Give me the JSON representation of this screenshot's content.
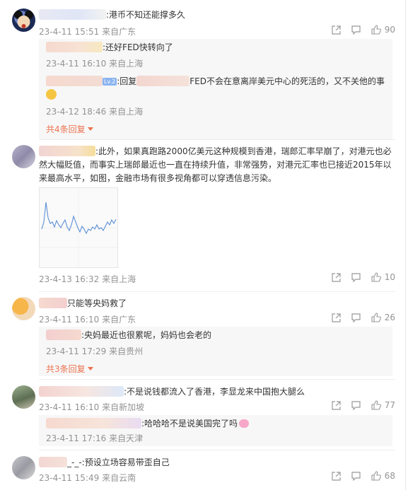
{
  "comments": [
    {
      "text": ":港币不知还能撑多久",
      "time": "23-4-11 15:51",
      "location": "来自广东",
      "likes": "90",
      "replies": [
        {
          "text": ":还好FED快转向了",
          "time": "23-4-11 16:10",
          "location": "来自上海"
        },
        {
          "prefix": ":回复",
          "text": "FED不会在意离岸美元中心的死活的，又不关他的事",
          "badge": "Lv.2",
          "time": "23-4-12 18:46",
          "location": "来自上海"
        }
      ],
      "more_replies": "共4条回复"
    },
    {
      "text": ":此外，如果真跑路2000亿美元这种规模到香港，瑞郎汇率早崩了，对港元也必然大幅贬值，而事实上瑞郎最近也一直在持续升值，非常强势，对港元汇率也已接近2015年以来最高水平，如图，金融市场有很多视角都可以穿透信息污染。",
      "time": "23-4-13 16:32",
      "location": "来自上海",
      "likes": "10"
    },
    {
      "text": "只能等央妈救了",
      "time": "23-4-11 16:10",
      "location": "来自广东",
      "likes": "26",
      "replies": [
        {
          "text": ":央妈最近也很累呢，妈妈也会老的",
          "time": "23-4-11 17:29",
          "location": "来自贵州"
        }
      ],
      "more_replies": "共3条回复"
    },
    {
      "text": ":不是说钱都流入了香港，李显龙来中国抱大腿么",
      "time": "23-4-11 16:10",
      "location": "来自新加坡",
      "likes": "77",
      "replies": [
        {
          "text": ":哈哈哈不是说美国完了吗",
          "time": "23-4-11 17:16",
          "location": "来自天津"
        }
      ]
    },
    {
      "name_suffix": "_-_-",
      "text": ":预设立场容易带歪自己",
      "time": "23-4-11 15:49",
      "location": "来自云南",
      "likes": "68"
    }
  ],
  "colors": {
    "link_orange": "#eb7350",
    "meta_gray": "#939393",
    "text": "#333333"
  },
  "icons": [
    "share-icon",
    "comment-icon",
    "thumbs-up-icon",
    "chevron-down-icon",
    "emoji-icon",
    "pig-emoji-icon"
  ]
}
